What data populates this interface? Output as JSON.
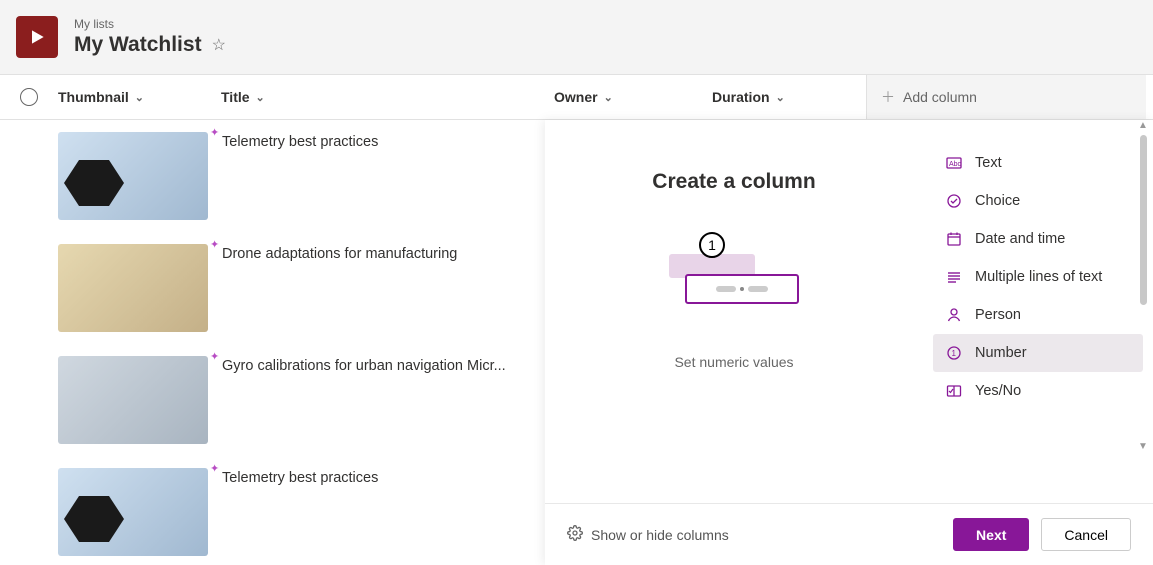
{
  "header": {
    "breadcrumb": "My lists",
    "title": "My Watchlist"
  },
  "columns": {
    "thumbnail": "Thumbnail",
    "title": "Title",
    "owner": "Owner",
    "duration": "Duration",
    "add": "Add column"
  },
  "rows": [
    {
      "title": "Telemetry best practices",
      "thumb_variant": "dark"
    },
    {
      "title": "Drone adaptations for manufacturing",
      "thumb_variant": "drone"
    },
    {
      "title": "Gyro calibrations for urban navigation Micr...",
      "thumb_variant": "urban"
    },
    {
      "title": "Telemetry best practices",
      "thumb_variant": "dark"
    }
  ],
  "panel": {
    "title": "Create a column",
    "preview_num": "1",
    "preview_desc": "Set numeric values",
    "types": [
      {
        "key": "text",
        "label": "Text"
      },
      {
        "key": "choice",
        "label": "Choice"
      },
      {
        "key": "datetime",
        "label": "Date and time"
      },
      {
        "key": "multiline",
        "label": "Multiple lines of text"
      },
      {
        "key": "person",
        "label": "Person"
      },
      {
        "key": "number",
        "label": "Number",
        "selected": true
      },
      {
        "key": "yesno",
        "label": "Yes/No"
      }
    ],
    "footer": {
      "show_hide": "Show or hide columns",
      "next": "Next",
      "cancel": "Cancel"
    }
  }
}
